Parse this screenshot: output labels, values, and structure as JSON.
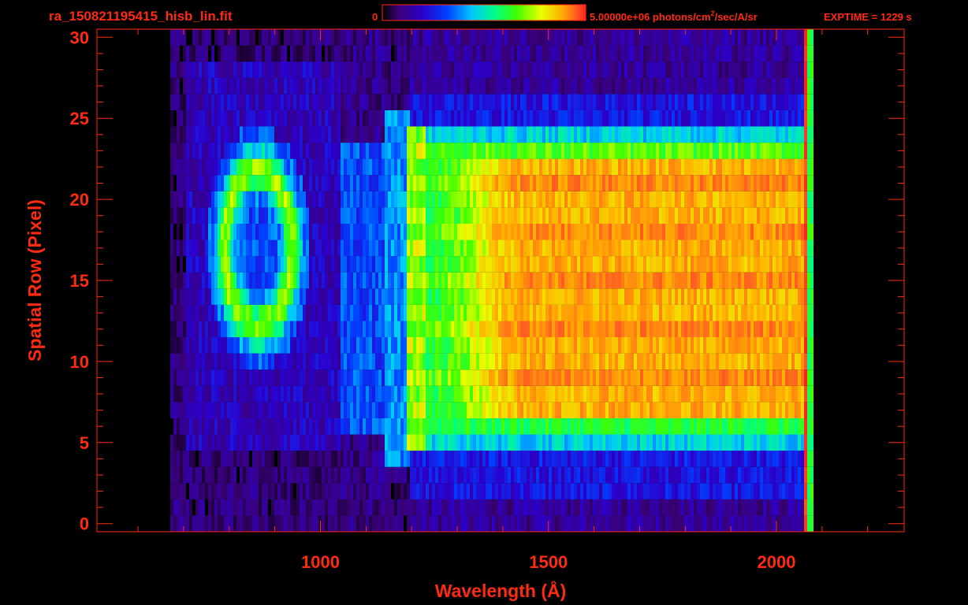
{
  "header": {
    "filename": "ra_150821195415_hisb_lin.fit",
    "colorbar_min_label": "0",
    "colorbar_max_label_pre": "5.00000e+06 photons/cm",
    "colorbar_max_label_sup": "2",
    "colorbar_max_label_post": "/sec/A/sr",
    "exptime": "EXPTIME = 1229 s"
  },
  "colors": {
    "text": "#ff2a12",
    "axes": "#ff2a12",
    "background": "#000000",
    "colormap": [
      "#000000",
      "#3a0078",
      "#2b00cc",
      "#0040ff",
      "#00c8ff",
      "#00ff80",
      "#40ff00",
      "#e8ff00",
      "#ffb000",
      "#ff6020",
      "#ff2020"
    ]
  },
  "chart_data": {
    "type": "heatmap",
    "title": "ra_150821195415_hisb_lin.fit",
    "xlabel": "Wavelength (Å)",
    "ylabel": "Spatial Row (Pixel)",
    "xlim": [
      510,
      2280
    ],
    "ylim": [
      -0.5,
      30.5
    ],
    "xticks": [
      1000,
      1500,
      2000
    ],
    "xtick_labels": [
      "1000",
      "1500",
      "2000"
    ],
    "yticks": [
      0,
      5,
      10,
      15,
      20,
      25,
      30
    ],
    "ytick_labels": [
      "0",
      "5",
      "10",
      "15",
      "20",
      "25",
      "30"
    ],
    "colorbar": {
      "min": 0,
      "max": 5000000,
      "units": "photons/cm2/sec/A/sr"
    },
    "exptime_s": 1229,
    "data_extent": {
      "x": [
        670,
        2080
      ],
      "rows": [
        0,
        30
      ]
    },
    "features": [
      {
        "name": "bright continuum",
        "x": [
          1200,
          2060
        ],
        "rows": [
          6,
          23
        ],
        "level": 0.78
      },
      {
        "name": "line feature",
        "x": [
          1185,
          1230
        ],
        "rows": [
          6,
          24
        ],
        "level": 0.7
      },
      {
        "name": "ring feature",
        "x_center": 860,
        "row_center": 17,
        "level": 0.5
      },
      {
        "name": "red edge",
        "x": 2060,
        "rows": [
          0,
          30
        ],
        "level": 0.97
      }
    ],
    "grid": false
  }
}
